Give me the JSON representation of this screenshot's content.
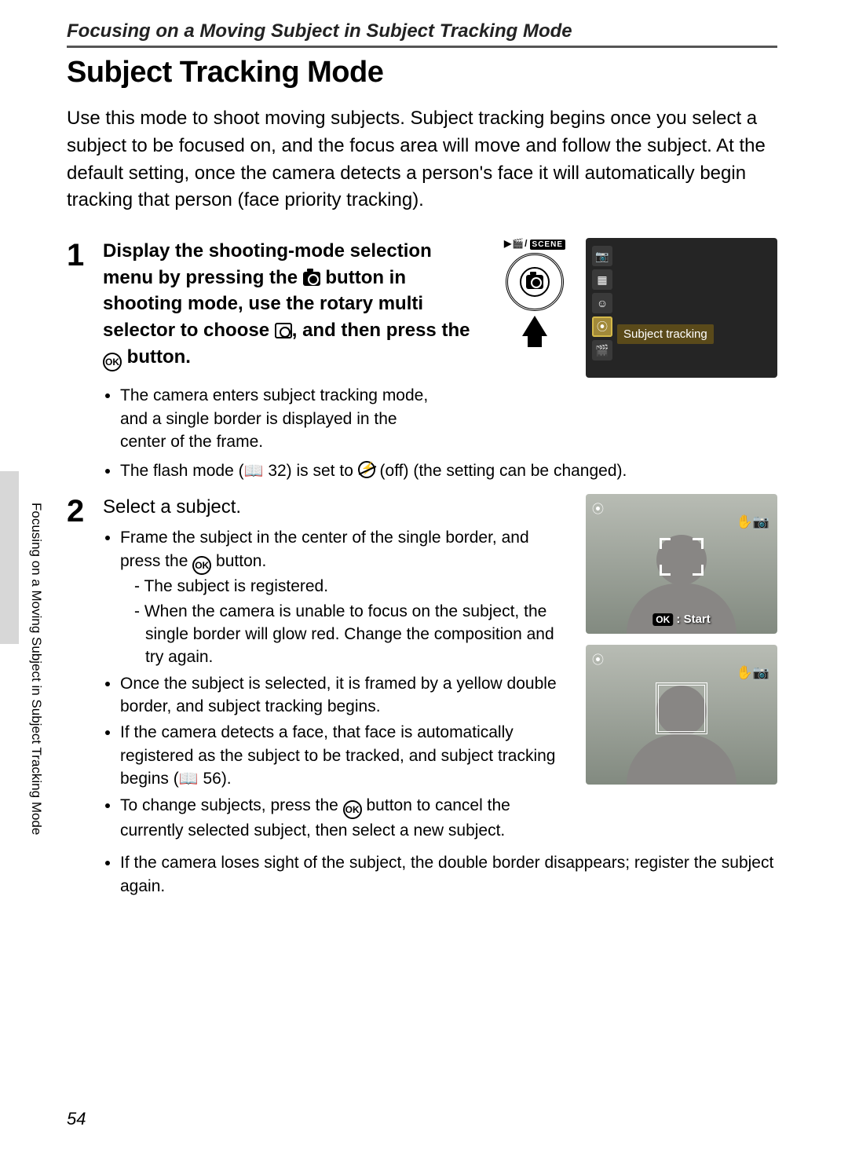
{
  "header": {
    "title": "Focusing on a Moving Subject in Subject Tracking Mode"
  },
  "title": "Subject Tracking Mode",
  "intro": "Use this mode to shoot moving subjects. Subject tracking begins once you select a subject to be focused on, and the focus area will move and follow the subject. At the default setting, once the camera detects a person's face it will automatically begin tracking that person (face priority tracking).",
  "side_text": "Focusing on a Moving Subject in Subject Tracking Mode",
  "page_number": "54",
  "dial": {
    "label_prefix": "▶",
    "scene": "SCENE"
  },
  "menu": {
    "label": "Subject tracking"
  },
  "step1": {
    "num": "1",
    "title_a": "Display the shooting-mode selection menu by pressing the ",
    "title_b": " button in shooting mode, use the rotary multi selector to choose ",
    "title_c": ", and then press the ",
    "title_d": " button.",
    "bullet1": "The camera enters subject tracking mode, and a single border is displayed in the center of the frame.",
    "bullet2_a": "The flash mode (",
    "bullet2_ref": " 32) is set to ",
    "bullet2_b": " (off) (the setting can be changed)."
  },
  "step2": {
    "num": "2",
    "title": "Select a subject.",
    "b1_a": "Frame the subject in the center of the single border, and press the ",
    "b1_b": " button.",
    "dash1": "The subject is registered.",
    "dash2": "When the camera is unable to focus on the subject, the single border will glow red. Change the composition and try again.",
    "b2": "Once the subject is selected, it is framed by a yellow double border, and subject tracking begins.",
    "b3_a": "If the camera detects a face, that face is automatically registered as the subject to be tracked, and subject tracking begins (",
    "b3_ref": " 56).",
    "b4_a": "To change subjects, press the ",
    "b4_b": " button to cancel the currently selected subject, then select a new subject.",
    "b5": "If the camera loses sight of the subject, the double border disappears; register the subject again."
  },
  "lcd": {
    "start_prefix": "OK",
    "start_label": " : Start"
  }
}
